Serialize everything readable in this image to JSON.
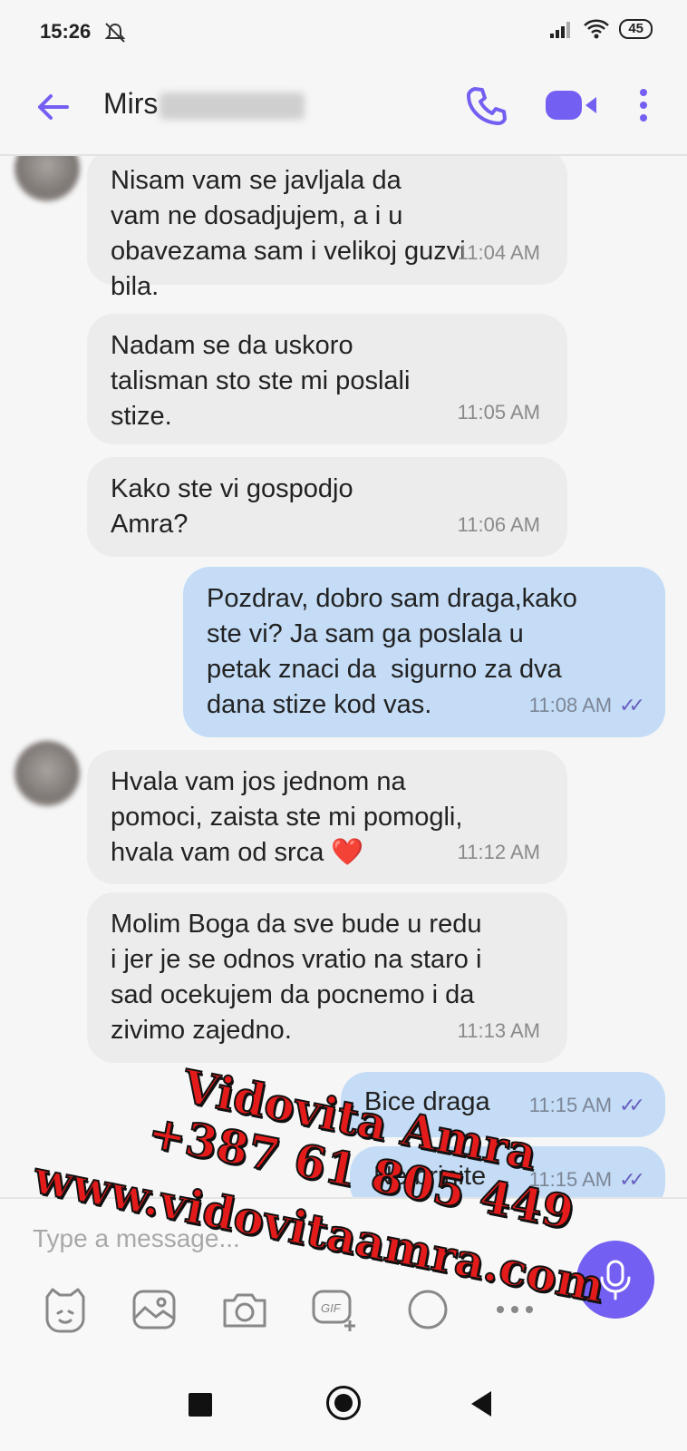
{
  "status_bar": {
    "time": "15:26",
    "battery": "45"
  },
  "header": {
    "contact_name_visible": "Mirs"
  },
  "messages": [
    {
      "dir": "in",
      "text": "Nisam vam se javljala da\nvam ne dosadjujem, a i u\nobavezama sam i velikoj guzvi\nbila.",
      "time": "11:04 AM"
    },
    {
      "dir": "in",
      "text": "Nadam se da uskoro\ntalisman sto ste mi poslali\nstize.",
      "time": "11:05 AM"
    },
    {
      "dir": "in",
      "text": "Kako ste vi gospodjo\nAmra?",
      "time": "11:06 AM"
    },
    {
      "dir": "out",
      "text": "Pozdrav, dobro sam draga,kako\nste vi? Ja sam ga poslala u\npetak znaci da  sigurno za dva\ndana stize kod vas.",
      "time": "11:08 AM"
    },
    {
      "dir": "in",
      "text": "Hvala vam jos jednom na\npomoci, zaista ste mi pomogli,\nhvala vam od srca ❤️",
      "time": "11:12 AM"
    },
    {
      "dir": "in",
      "text": "Molim Boga da sve bude u redu\ni jer je se odnos vratio na staro i\nsad ocekujem da pocnemo i da\nzivimo zajedno.",
      "time": "11:13 AM"
    },
    {
      "dir": "out",
      "text": "Bice draga",
      "time": "11:15 AM"
    },
    {
      "dir": "out",
      "text": "Ne brinite",
      "time": "11:15 AM"
    }
  ],
  "composer": {
    "placeholder": "Type a message..."
  },
  "watermark": {
    "line1": "Vidovita Amra",
    "line2": "+387 61 805 449",
    "line3": "www.vidovitaamra.com"
  },
  "colors": {
    "accent": "#7360f2",
    "incoming_bubble": "#ececec",
    "outgoing_bubble": "#c4dcf6",
    "watermark": "#e41b1b"
  }
}
